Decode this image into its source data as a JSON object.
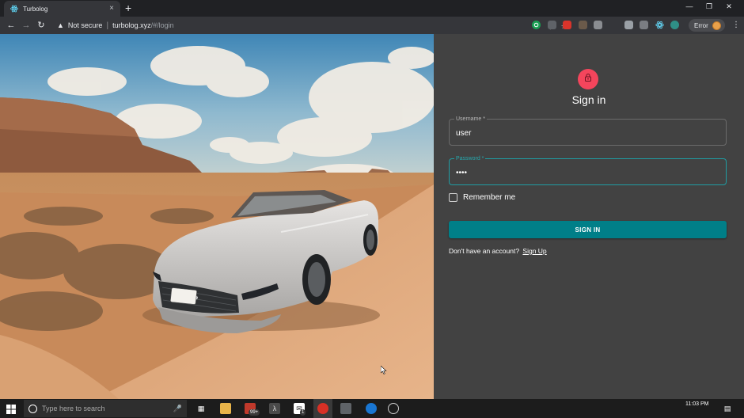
{
  "browser": {
    "tab_title": "Turbolog",
    "tab_close": "×",
    "new_tab": "+",
    "security_label": "Not secure",
    "url_host": "turbolog.xyz",
    "url_path": "/#/login",
    "error_label": "Error"
  },
  "login": {
    "title": "Sign in",
    "username_label": "Username *",
    "username_value": "user",
    "password_label": "Password *",
    "password_value": "••••",
    "remember_label": "Remember me",
    "submit_label": "SIGN IN",
    "no_account_text": "Don't have an account?",
    "signup_link": "Sign Up"
  },
  "taskbar": {
    "search_placeholder": "Type here to search",
    "badge_mail": "99+",
    "badge_count": "1",
    "clock": "11:03 PM"
  },
  "colors": {
    "panel_bg": "#424242",
    "accent": "#007f88",
    "focus_border": "#1f9da3",
    "avatar": "#f4455c"
  }
}
